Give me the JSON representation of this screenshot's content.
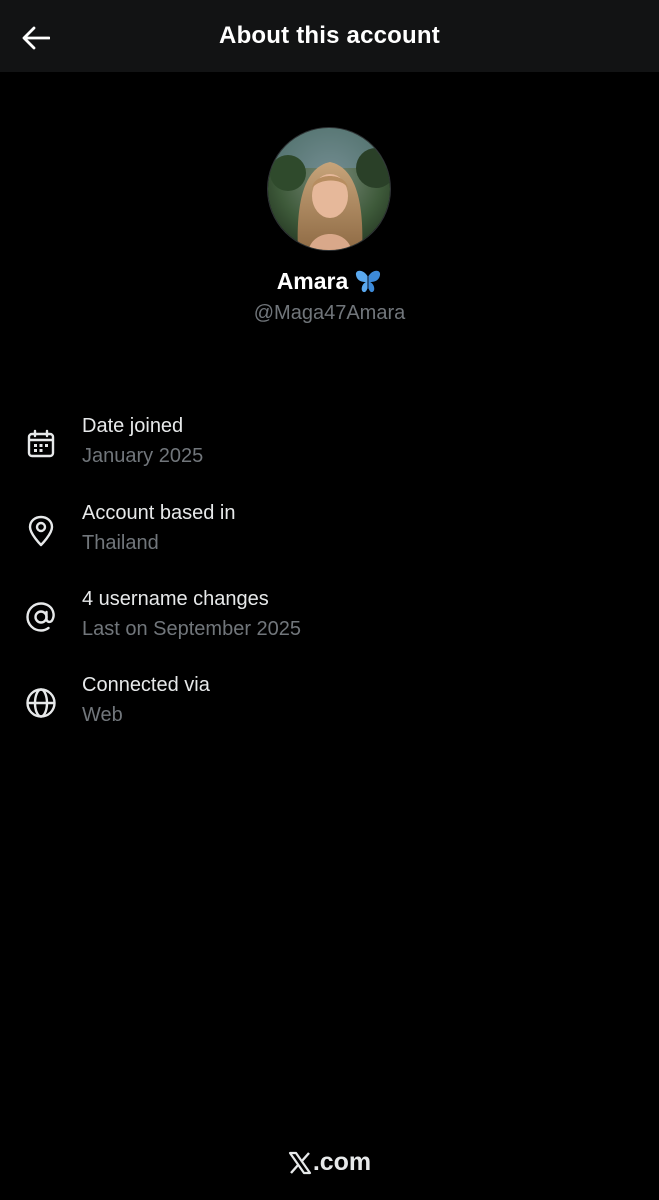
{
  "header": {
    "title": "About this account",
    "back_icon": "arrow-left-icon"
  },
  "profile": {
    "display_name": "Amara",
    "name_emoji": "butterfly-icon",
    "handle": "@Maga47Amara"
  },
  "info": [
    {
      "icon": "calendar-icon",
      "title": "Date joined",
      "value": "January 2025"
    },
    {
      "icon": "location-pin-icon",
      "title": "Account based in",
      "value": "Thailand"
    },
    {
      "icon": "at-sign-icon",
      "title": "4 username changes",
      "value": "Last on September 2025"
    },
    {
      "icon": "globe-icon",
      "title": "Connected via",
      "value": "Web"
    }
  ],
  "footer": {
    "brand_suffix": ".com",
    "brand_icon": "x-logo-icon"
  },
  "colors": {
    "background": "#000000",
    "header_bg": "#121314",
    "primary_text": "#e7e9ea",
    "secondary_text": "#71767b",
    "butterfly": "#4a9de8"
  }
}
